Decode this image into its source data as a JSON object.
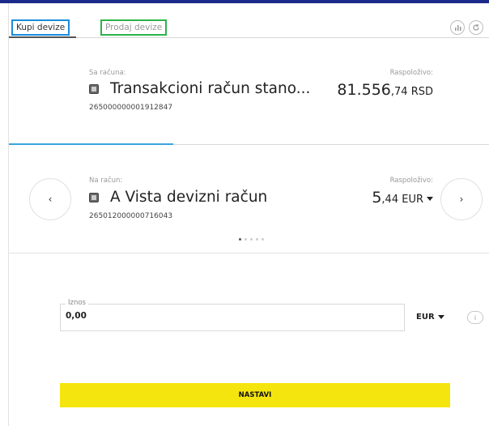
{
  "tabs": {
    "buy": "Kupi devize",
    "sell": "Prodaj devize"
  },
  "header_icons": [
    "stats-icon",
    "refresh-icon"
  ],
  "from_account": {
    "label": "Sa računa:",
    "name": "Transakcioni račun stano...",
    "number": "265000000001912847",
    "available_label": "Raspoloživo:",
    "amount_main": "81.556",
    "amount_decimals": ",74 RSD"
  },
  "to_account": {
    "label": "Na račun:",
    "name": "A Vista devizni račun",
    "number": "265012000000716043",
    "available_label": "Raspoloživo:",
    "amount_main": "5",
    "amount_decimals": ",44 EUR"
  },
  "carousel": {
    "prev": "‹",
    "next": "›",
    "dots": 5,
    "active_dot": 0
  },
  "amount": {
    "label": "Iznos",
    "value": "0,00"
  },
  "currency": {
    "selected": "EUR"
  },
  "info": {
    "symbol": "i"
  },
  "submit": {
    "label": "NASTAVI"
  },
  "colors": {
    "accent_yellow": "#f5e50f",
    "brand_blue": "#1b2a8a",
    "active_line": "#3aa4dc"
  }
}
